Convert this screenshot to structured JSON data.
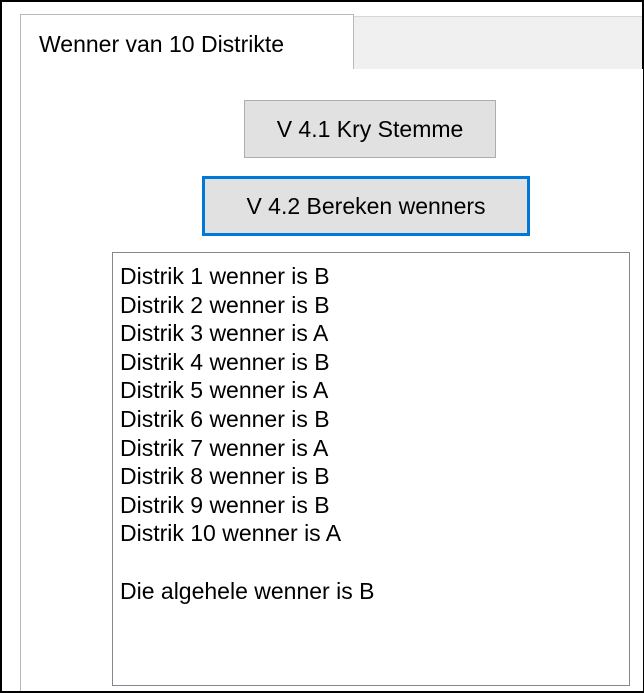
{
  "tab": {
    "label": "Wenner van 10 Distrikte"
  },
  "buttons": {
    "get_votes": "V 4.1 Kry Stemme",
    "calculate_winners": "V 4.2 Bereken wenners"
  },
  "output": {
    "lines": [
      "Distrik 1 wenner is B",
      "Distrik 2 wenner is B",
      "Distrik 3 wenner is A",
      "Distrik 4 wenner is B",
      "Distrik 5 wenner is A",
      "Distrik 6 wenner is B",
      "Distrik 7 wenner is A",
      "Distrik 8 wenner is B",
      "Distrik 9 wenner is B",
      "Distrik 10 wenner is A"
    ],
    "overall": "Die algehele wenner is B"
  },
  "colors": {
    "focus_border": "#0078d7",
    "button_face": "#e1e1e1",
    "tab_strip": "#f0f0f0"
  }
}
